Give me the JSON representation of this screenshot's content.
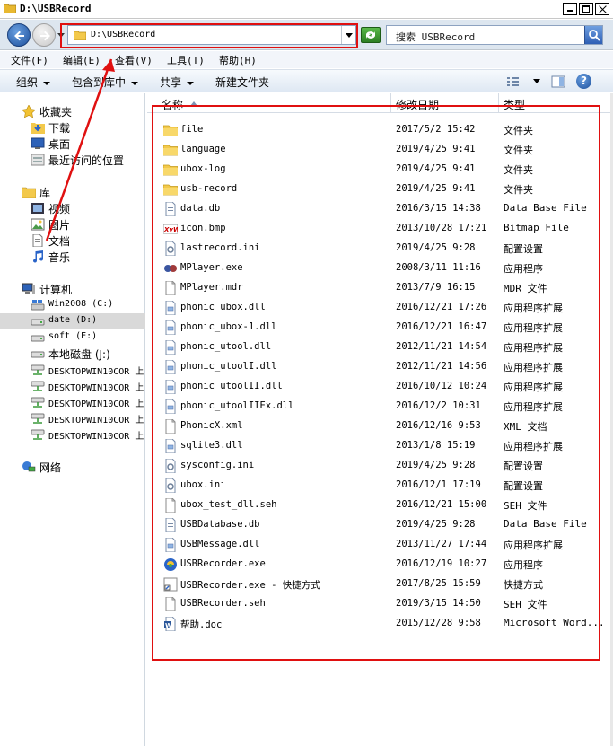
{
  "window": {
    "title": "D:\\USBRecord"
  },
  "address": {
    "path": "D:\\USBRecord"
  },
  "search": {
    "placeholder": "搜索 USBRecord"
  },
  "menu": [
    "文件(F)",
    "编辑(E)",
    "查看(V)",
    "工具(T)",
    "帮助(H)"
  ],
  "toolbar": {
    "organize": "组织",
    "include": "包含到库中",
    "share": "共享",
    "newfolder": "新建文件夹",
    "help": "?"
  },
  "nav": {
    "favorites": "收藏夹",
    "downloads": "下载",
    "desktop": "桌面",
    "recent": "最近访问的位置",
    "libraries": "库",
    "videos": "视频",
    "pictures": "图片",
    "documents": "文档",
    "music": "音乐",
    "computer": "计算机",
    "drives": [
      "Win2008 (C:)",
      "date (D:)",
      "soft (E:)",
      "本地磁盘 (J:)"
    ],
    "network_drives": [
      "DESKTOPWIN10COR 上",
      "DESKTOPWIN10COR 上",
      "DESKTOPWIN10COR 上",
      "DESKTOPWIN10COR 上",
      "DESKTOPWIN10COR 上"
    ],
    "network": "网络"
  },
  "columns": {
    "name": "名称",
    "date": "修改日期",
    "type": "类型"
  },
  "files": [
    {
      "name": "file",
      "date": "2017/5/2 15:42",
      "type": "文件夹",
      "icon": "folder"
    },
    {
      "name": "language",
      "date": "2019/4/25 9:41",
      "type": "文件夹",
      "icon": "folder"
    },
    {
      "name": "ubox-log",
      "date": "2019/4/25 9:41",
      "type": "文件夹",
      "icon": "folder"
    },
    {
      "name": "usb-record",
      "date": "2019/4/25 9:41",
      "type": "文件夹",
      "icon": "folder"
    },
    {
      "name": "data.db",
      "date": "2016/3/15 14:38",
      "type": "Data Base File",
      "icon": "db"
    },
    {
      "name": "icon.bmp",
      "date": "2013/10/28 17:21",
      "type": "Bitmap File",
      "icon": "bmp"
    },
    {
      "name": "lastrecord.ini",
      "date": "2019/4/25 9:28",
      "type": "配置设置",
      "icon": "ini"
    },
    {
      "name": "MPlayer.exe",
      "date": "2008/3/11 11:16",
      "type": "应用程序",
      "icon": "mplayer"
    },
    {
      "name": "MPlayer.mdr",
      "date": "2013/7/9 16:15",
      "type": "MDR 文件",
      "icon": "blank"
    },
    {
      "name": "phonic_ubox.dll",
      "date": "2016/12/21 17:26",
      "type": "应用程序扩展",
      "icon": "dll"
    },
    {
      "name": "phonic_ubox-1.dll",
      "date": "2016/12/21 16:47",
      "type": "应用程序扩展",
      "icon": "dll"
    },
    {
      "name": "phonic_utool.dll",
      "date": "2012/11/21 14:54",
      "type": "应用程序扩展",
      "icon": "dll"
    },
    {
      "name": "phonic_utoolI.dll",
      "date": "2012/11/21 14:56",
      "type": "应用程序扩展",
      "icon": "dll"
    },
    {
      "name": "phonic_utoolII.dll",
      "date": "2016/10/12 10:24",
      "type": "应用程序扩展",
      "icon": "dll"
    },
    {
      "name": "phonic_utoolIIEx.dll",
      "date": "2016/12/2 10:31",
      "type": "应用程序扩展",
      "icon": "dll"
    },
    {
      "name": "PhonicX.xml",
      "date": "2016/12/16 9:53",
      "type": "XML 文档",
      "icon": "blank"
    },
    {
      "name": "sqlite3.dll",
      "date": "2013/1/8 15:19",
      "type": "应用程序扩展",
      "icon": "dll"
    },
    {
      "name": "sysconfig.ini",
      "date": "2019/4/25 9:28",
      "type": "配置设置",
      "icon": "ini"
    },
    {
      "name": "ubox.ini",
      "date": "2016/12/1 17:19",
      "type": "配置设置",
      "icon": "ini"
    },
    {
      "name": "ubox_test_dll.seh",
      "date": "2016/12/21 15:00",
      "type": "SEH 文件",
      "icon": "blank"
    },
    {
      "name": "USBDatabase.db",
      "date": "2019/4/25 9:28",
      "type": "Data Base File",
      "icon": "db"
    },
    {
      "name": "USBMessage.dll",
      "date": "2013/11/27 17:44",
      "type": "应用程序扩展",
      "icon": "dll"
    },
    {
      "name": "USBRecorder.exe",
      "date": "2016/12/19 10:27",
      "type": "应用程序",
      "icon": "exe"
    },
    {
      "name": "USBRecorder.exe - 快捷方式",
      "date": "2017/8/25 15:59",
      "type": "快捷方式",
      "icon": "lnk"
    },
    {
      "name": "USBRecorder.seh",
      "date": "2019/3/15 14:50",
      "type": "SEH 文件",
      "icon": "blank"
    },
    {
      "name": "帮助.doc",
      "date": "2015/12/28 9:58",
      "type": "Microsoft Word...",
      "icon": "doc"
    }
  ],
  "colors": {
    "annotation": "#e01010",
    "selection": "#d9d9d9",
    "folder": "#f3c94b"
  }
}
